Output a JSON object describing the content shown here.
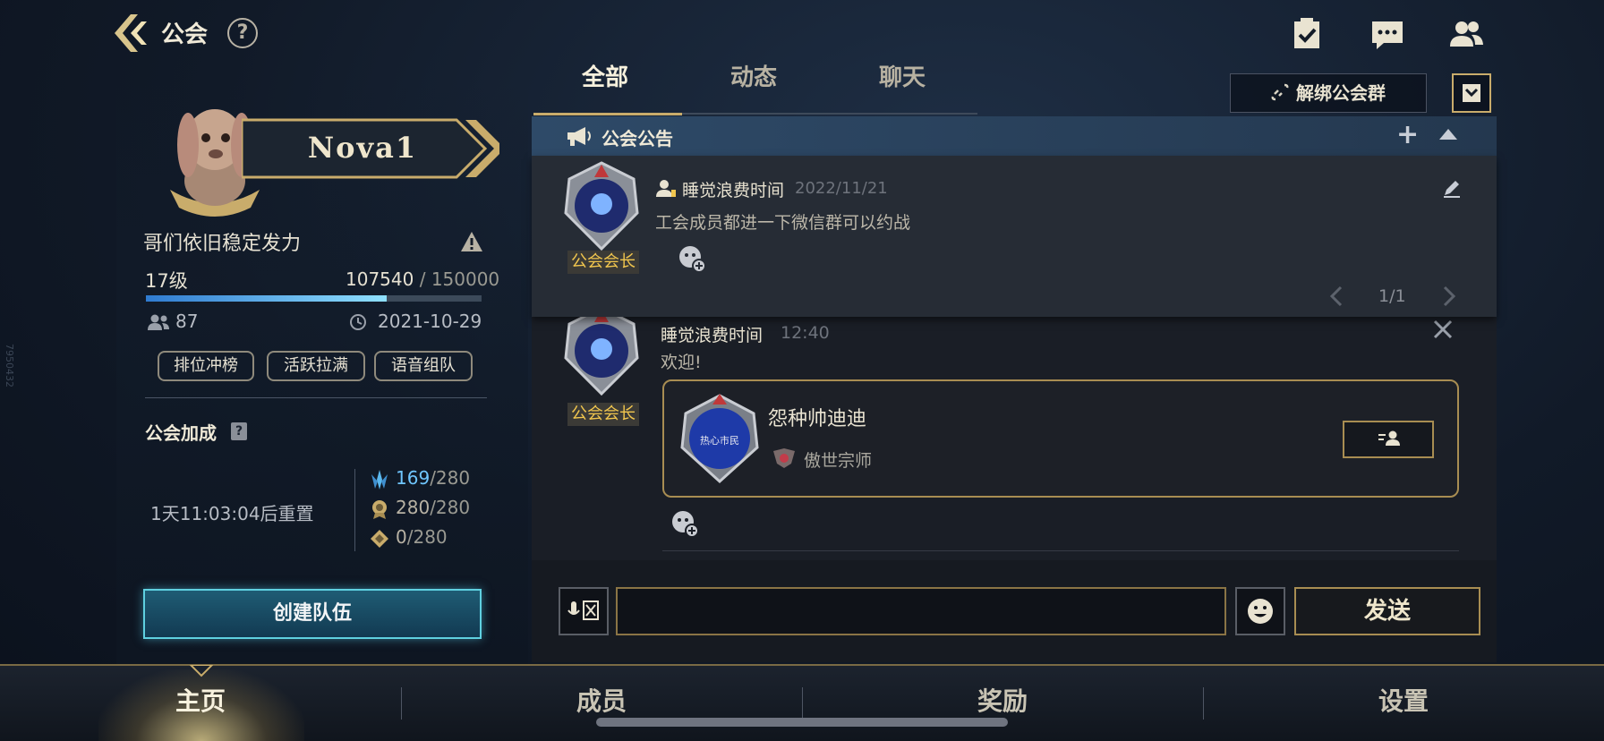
{
  "app": {
    "title": "公会",
    "side_id": "7950432"
  },
  "header": {
    "icons": [
      "checklist-icon",
      "chat-bubble-icon",
      "friends-icon"
    ]
  },
  "profile": {
    "player_name": "Nova1",
    "motto": "哥们依旧稳定发力",
    "level": "17级",
    "exp_current": "107540",
    "exp_max": " / 150000",
    "exp_progress": 0.717,
    "member_count": "87",
    "created_date": "2021-10-29",
    "tags": [
      "排位冲榜",
      "活跃拉满",
      "语音组队"
    ],
    "bonus_title": "公会加成",
    "bonus_help": "?",
    "reset_text": "1天11:03:04后重置",
    "stats": [
      {
        "value": "169",
        "max": "/280",
        "icon": "crystal-icon",
        "color": "#6fc6ff"
      },
      {
        "value": "280",
        "max": "/280",
        "icon": "medal-icon",
        "color": "#b8b2a4"
      },
      {
        "value": "0",
        "max": "/280",
        "icon": "diamond-icon",
        "color": "#b8b2a4"
      }
    ],
    "create_team_label": "创建队伍"
  },
  "tabs": [
    {
      "label": "全部",
      "active": true
    },
    {
      "label": "动态",
      "active": false
    },
    {
      "label": "聊天",
      "active": false
    }
  ],
  "unbind_label": "解绑公会群",
  "notice": {
    "title": "公会公告",
    "author": "睡觉浪费时间",
    "date": "2022/11/21",
    "text": "工会成员都进一下微信群可以约战",
    "role": "公会会长",
    "pager": "1/1"
  },
  "message": {
    "author": "睡觉浪费时间",
    "time": "12:40",
    "text": "欢迎!",
    "role": "公会会长",
    "card": {
      "name": "怨种帅迪迪",
      "avatar_text": "热心市民",
      "rank": "傲世宗师"
    }
  },
  "input": {
    "placeholder": "",
    "send_label": "发送"
  },
  "bottom_nav": [
    {
      "label": "主页",
      "active": true
    },
    {
      "label": "成员",
      "active": false
    },
    {
      "label": "奖励",
      "active": false
    },
    {
      "label": "设置",
      "active": false
    }
  ],
  "colors": {
    "accent_gold": "#c9ac6b",
    "progress": "#2f7bd0",
    "role_text": "#f1c64e"
  }
}
